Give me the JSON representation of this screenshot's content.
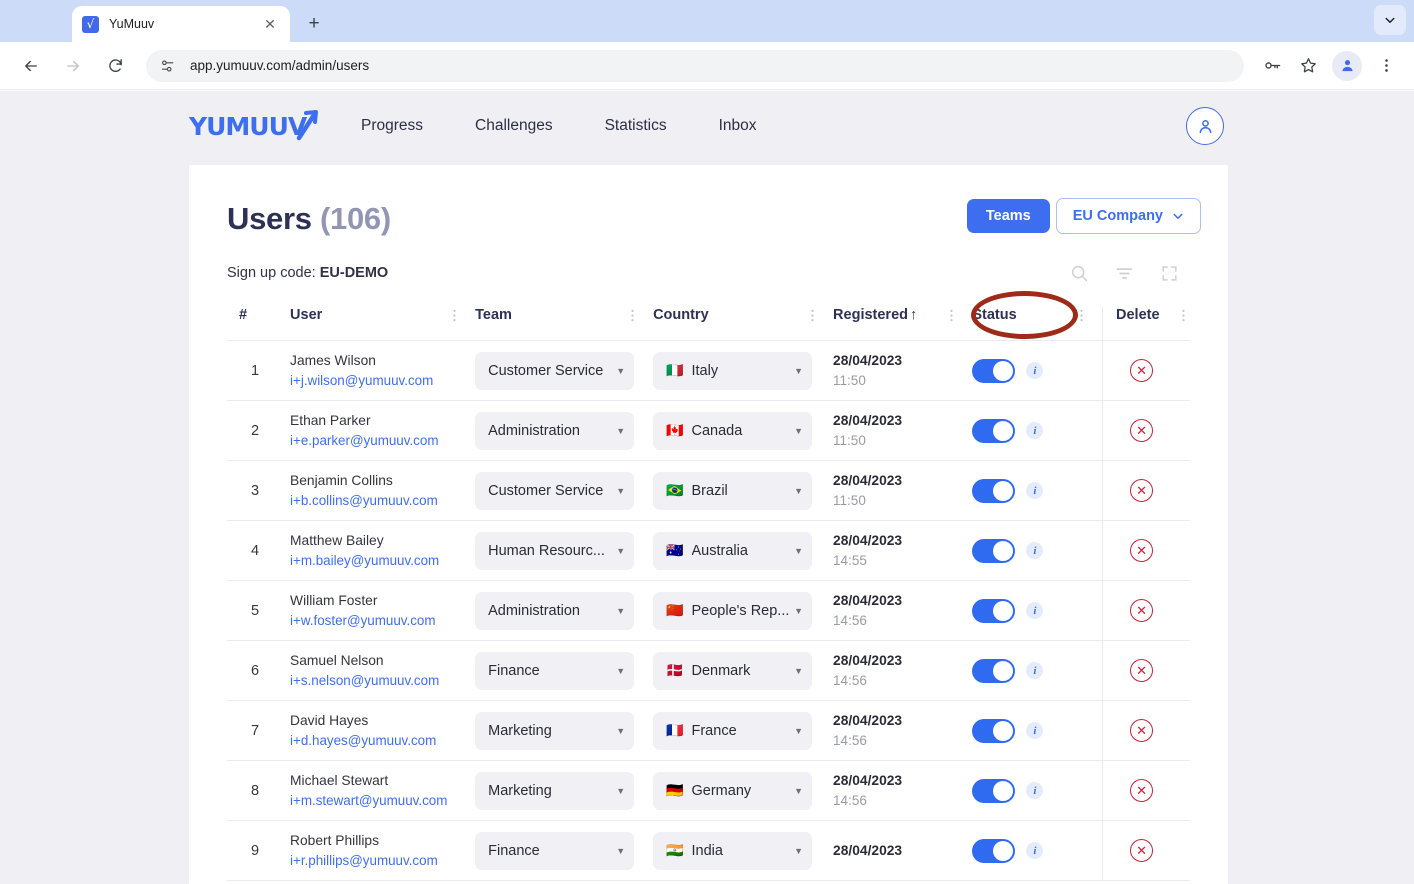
{
  "browser": {
    "tab": {
      "title": "YuMuuv",
      "favicon_label": "√",
      "close_label": "✕"
    },
    "newtab_label": "+",
    "back_label": "←",
    "forward_label": "→",
    "reload_label": "⟳",
    "url": "app.yumuuv.com/admin/users",
    "icons": {
      "site_info": "site-info-icon",
      "password_key": "key-icon",
      "bookmark_star": "star-icon",
      "profile": "profile-avatar-icon",
      "menu": "three-dot-menu-icon",
      "tabstrip_chevron": "chevron-down-icon"
    }
  },
  "app": {
    "logo_text": "YUMUUV",
    "nav": [
      {
        "label": "Progress"
      },
      {
        "label": "Challenges"
      },
      {
        "label": "Statistics"
      },
      {
        "label": "Inbox"
      }
    ]
  },
  "header": {
    "title": "Users",
    "count": "(106)",
    "teams_button": "Teams",
    "company_select": "EU Company",
    "company_caret": "⌄",
    "signup_code_label": "Sign up code:",
    "signup_code_value": "EU-DEMO"
  },
  "toolbar_icons": [
    {
      "name": "search-icon"
    },
    {
      "name": "filter-icon"
    },
    {
      "name": "fullscreen-icon"
    }
  ],
  "table": {
    "columns": [
      {
        "key": "num",
        "label": "#",
        "menu": false
      },
      {
        "key": "user",
        "label": "User",
        "menu": true
      },
      {
        "key": "team",
        "label": "Team",
        "menu": true
      },
      {
        "key": "country",
        "label": "Country",
        "menu": true
      },
      {
        "key": "registered",
        "label": "Registered",
        "sort": "↑",
        "menu": true
      },
      {
        "key": "status",
        "label": "Status",
        "menu": true
      },
      {
        "key": "delete",
        "label": "Delete",
        "menu": true
      }
    ],
    "rows": [
      {
        "num": "1",
        "name": "James Wilson",
        "email": "i+j.wilson@yumuuv.com",
        "team": "Customer Service",
        "flag": "🇮🇹",
        "country": "Italy",
        "date": "28/04/2023",
        "time": "11:50",
        "status": true
      },
      {
        "num": "2",
        "name": "Ethan Parker",
        "email": "i+e.parker@yumuuv.com",
        "team": "Administration",
        "flag": "🇨🇦",
        "country": "Canada",
        "date": "28/04/2023",
        "time": "11:50",
        "status": true
      },
      {
        "num": "3",
        "name": "Benjamin Collins",
        "email": "i+b.collins@yumuuv.com",
        "team": "Customer Service",
        "flag": "🇧🇷",
        "country": "Brazil",
        "date": "28/04/2023",
        "time": "11:50",
        "status": true
      },
      {
        "num": "4",
        "name": "Matthew Bailey",
        "email": "i+m.bailey@yumuuv.com",
        "team": "Human Resourc...",
        "flag": "🇦🇺",
        "country": "Australia",
        "date": "28/04/2023",
        "time": "14:55",
        "status": true
      },
      {
        "num": "5",
        "name": "William Foster",
        "email": "i+w.foster@yumuuv.com",
        "team": "Administration",
        "flag": "🇨🇳",
        "country": "People's Rep...",
        "date": "28/04/2023",
        "time": "14:56",
        "status": true
      },
      {
        "num": "6",
        "name": "Samuel Nelson",
        "email": "i+s.nelson@yumuuv.com",
        "team": "Finance",
        "flag": "🇩🇰",
        "country": "Denmark",
        "date": "28/04/2023",
        "time": "14:56",
        "status": true
      },
      {
        "num": "7",
        "name": "David Hayes",
        "email": "i+d.hayes@yumuuv.com",
        "team": "Marketing",
        "flag": "🇫🇷",
        "country": "France",
        "date": "28/04/2023",
        "time": "14:56",
        "status": true
      },
      {
        "num": "8",
        "name": "Michael Stewart",
        "email": "i+m.stewart@yumuuv.com",
        "team": "Marketing",
        "flag": "🇩🇪",
        "country": "Germany",
        "date": "28/04/2023",
        "time": "14:56",
        "status": true
      },
      {
        "num": "9",
        "name": "Robert Phillips",
        "email": "i+r.phillips@yumuuv.com",
        "team": "Finance",
        "flag": "🇮🇳",
        "country": "India",
        "date": "28/04/2023",
        "time": "",
        "status": true
      }
    ],
    "delete_icon": "✕"
  },
  "annotation": {
    "shape": "ellipse-highlight",
    "color": "#9e2a18",
    "target": "Teams"
  },
  "colors": {
    "accent_blue": "#3d6ef0",
    "title_navy": "#2e3157",
    "page_bg": "#f0f0f4",
    "delete_red": "#cc2136",
    "annotation_red": "#9e2a18"
  }
}
